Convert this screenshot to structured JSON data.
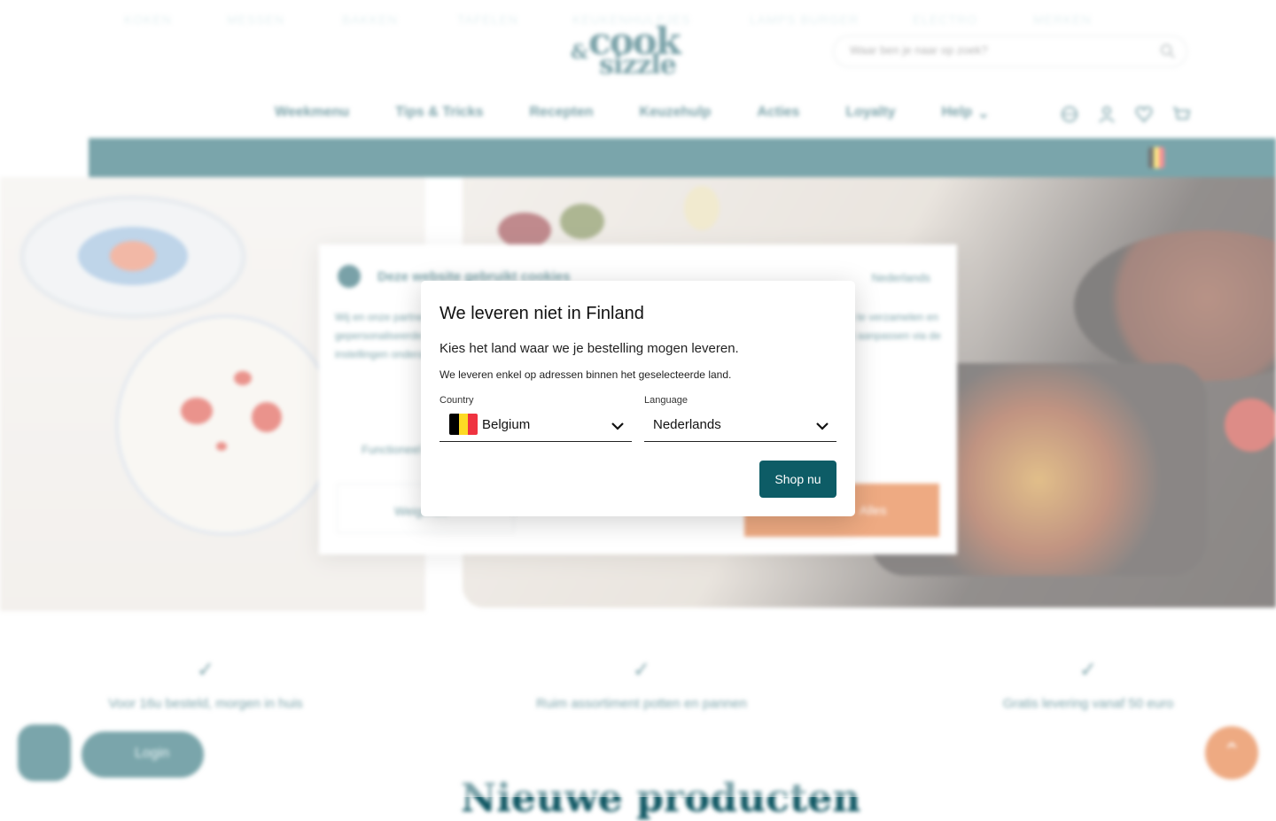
{
  "header": {
    "logo": {
      "amp": "&",
      "line1": "cook",
      "line2": "sizzle"
    },
    "search": {
      "placeholder": "Waar ben je naar op zoek?",
      "icon": "search-icon"
    },
    "nav": [
      "Weekmenu",
      "Tips & Tricks",
      "Recepten",
      "Keuzehulp",
      "Acties",
      "Loyalty",
      "Help"
    ],
    "icons": [
      "globe-icon",
      "user-icon",
      "heart-icon",
      "cart-icon"
    ]
  },
  "categories": [
    "KOKEN",
    "MESSEN",
    "BAKKEN",
    "TAFELEN",
    "KEUKENHULPJES",
    "LAMPS BURGER",
    "ELECTRO",
    "MERKEN"
  ],
  "cookie": {
    "title": "Deze website gebruikt cookies",
    "language": "Nederlands",
    "body": "Wij en onze partners gebruiken cookies en vergelijkbare technieken om uw ervaring te verbeteren, statistieken te verzamelen en gepersonaliseerde advertenties te tonen. Lees meer in ons cookiebeleid. Je kunt je voorkeuren op elk moment aanpassen via de instellingen onderaan de website.",
    "checkbox": "Functioneel",
    "btn_left": "Weigeren",
    "btn_right": "Alles"
  },
  "usps": [
    "Voor 16u besteld, morgen in huis",
    "Ruim assortiment potten en pannen",
    "Gratis levering vanaf 50 euro"
  ],
  "login_label": "Login",
  "section_heading": "Nieuwe producten",
  "modal": {
    "title": "We leveren niet in Finland",
    "subtitle": "Kies het land waar we je bestelling mogen leveren.",
    "note": "We leveren enkel op adressen binnen het geselecteerde land.",
    "country_label": "Country",
    "country_value": "Belgium",
    "country_flag": [
      "#000000",
      "#FDDA24",
      "#EF3340"
    ],
    "language_label": "Language",
    "language_value": "Nederlands",
    "button": "Shop nu"
  },
  "colors": {
    "brand": "#0d5c66",
    "accent": "#e0651d"
  }
}
